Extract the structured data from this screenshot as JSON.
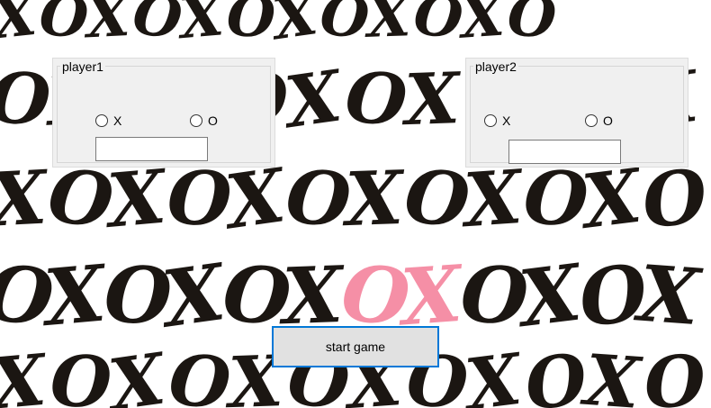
{
  "player1": {
    "title": "player1",
    "option_x": "X",
    "option_o": "O",
    "name_value": ""
  },
  "player2": {
    "title": "player2",
    "option_x": "X",
    "option_o": "O",
    "name_value": ""
  },
  "start_button": {
    "label": "start game"
  },
  "background": {
    "description_icon": "xo-pattern-background",
    "ink_color": "#1b1612",
    "accent_color": "#f58fa6"
  },
  "colors": {
    "panel_bg": "#f0f0f0",
    "button_bg": "#e1e1e1",
    "button_border": "#0078d7"
  }
}
